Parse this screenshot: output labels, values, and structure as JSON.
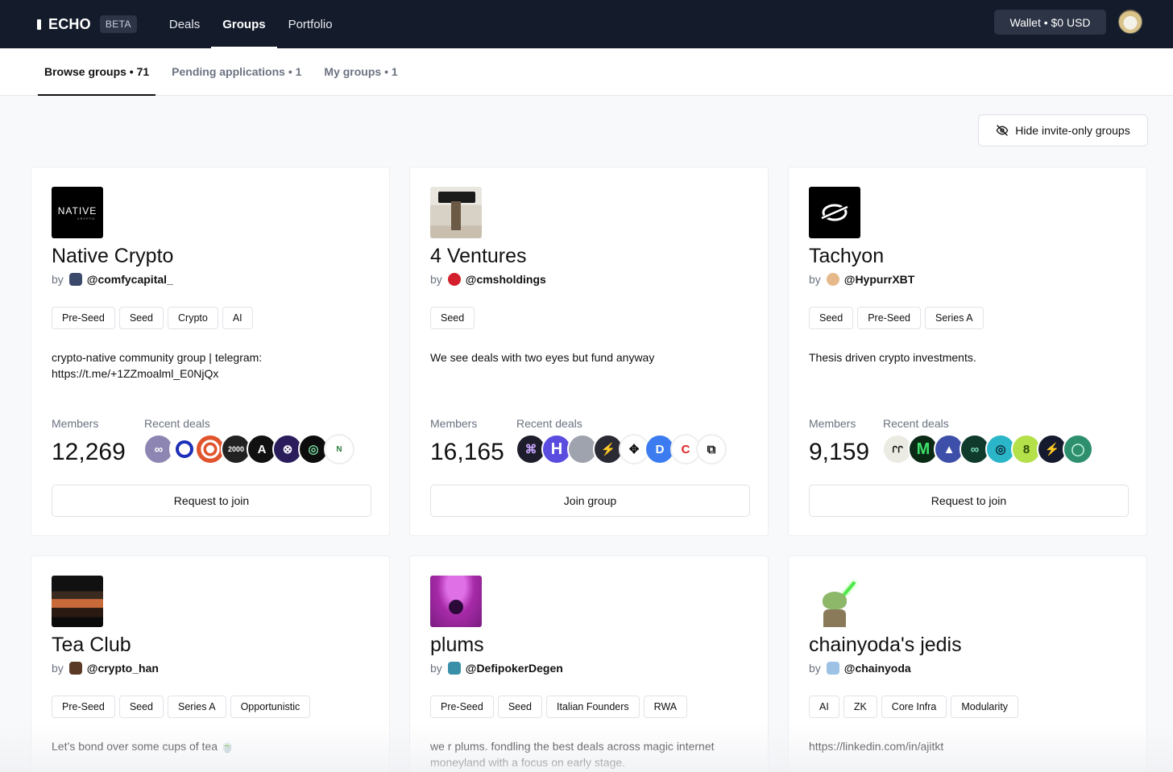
{
  "nav": {
    "logo": "ECHO",
    "beta": "BETA",
    "links": [
      "Deals",
      "Groups",
      "Portfolio"
    ],
    "wallet": "Wallet • $0 USD"
  },
  "subtabs": [
    "Browse groups • 71",
    "Pending applications • 1",
    "My groups • 1"
  ],
  "hide_invite_only": "Hide invite-only groups",
  "labels": {
    "members": "Members",
    "recent_deals": "Recent deals",
    "by": "by"
  },
  "groups": [
    {
      "name": "Native Crypto",
      "handle": "@comfycapital_",
      "logo_text": "NATIVE",
      "logo_subtext": "CRYPTO",
      "tags": [
        "Pre-Seed",
        "Seed",
        "Crypto",
        "AI"
      ],
      "description": "crypto-native community group | telegram: https://t.me/+1ZZmoalml_E0NjQx",
      "members": "12,269",
      "button": "Request to join",
      "deal_colors": [
        "#8d86b3",
        "#ffffff",
        "#e0552d",
        "#222222",
        "#111111",
        "#2b1c5c",
        "#0d0d0d",
        "#ffffff"
      ]
    },
    {
      "name": "4 Ventures",
      "handle": "@cmsholdings",
      "tags": [
        "Seed"
      ],
      "description": "We see deals with two eyes but fund anyway",
      "members": "16,165",
      "button": "Join group",
      "deal_colors": [
        "#1d1d2b",
        "#5b4ce0",
        "#9ea3ad",
        "#2a2a35",
        "#ffffff",
        "#3c7cf0",
        "#ffffff",
        "#ffffff"
      ]
    },
    {
      "name": "Tachyon",
      "handle": "@HypurrXBT",
      "tags": [
        "Seed",
        "Pre-Seed",
        "Series A"
      ],
      "description": "Thesis driven crypto investments.",
      "members": "9,159",
      "button": "Request to join",
      "deal_colors": [
        "#ecebe3",
        "#0b2a16",
        "#3d4fa8",
        "#0f3a2c",
        "#2bb5c9",
        "#b4e04a",
        "#151a2e",
        "#2e8f6e"
      ]
    },
    {
      "name": "Tea Club",
      "handle": "@crypto_han",
      "tags": [
        "Pre-Seed",
        "Seed",
        "Series A",
        "Opportunistic"
      ],
      "description": "Let’s bond over some cups of tea 🍵"
    },
    {
      "name": "plums",
      "handle": "@DefipokerDegen",
      "tags": [
        "Pre-Seed",
        "Seed",
        "Italian Founders",
        "RWA"
      ],
      "description": "we r plums. fondling the best deals across magic internet moneyland with a focus on early stage."
    },
    {
      "name": "chainyoda's jedis",
      "handle": "@chainyoda",
      "tags": [
        "AI",
        "ZK",
        "Core Infra",
        "Modularity"
      ],
      "description": "https://linkedin.com/in/ajitkt"
    }
  ]
}
